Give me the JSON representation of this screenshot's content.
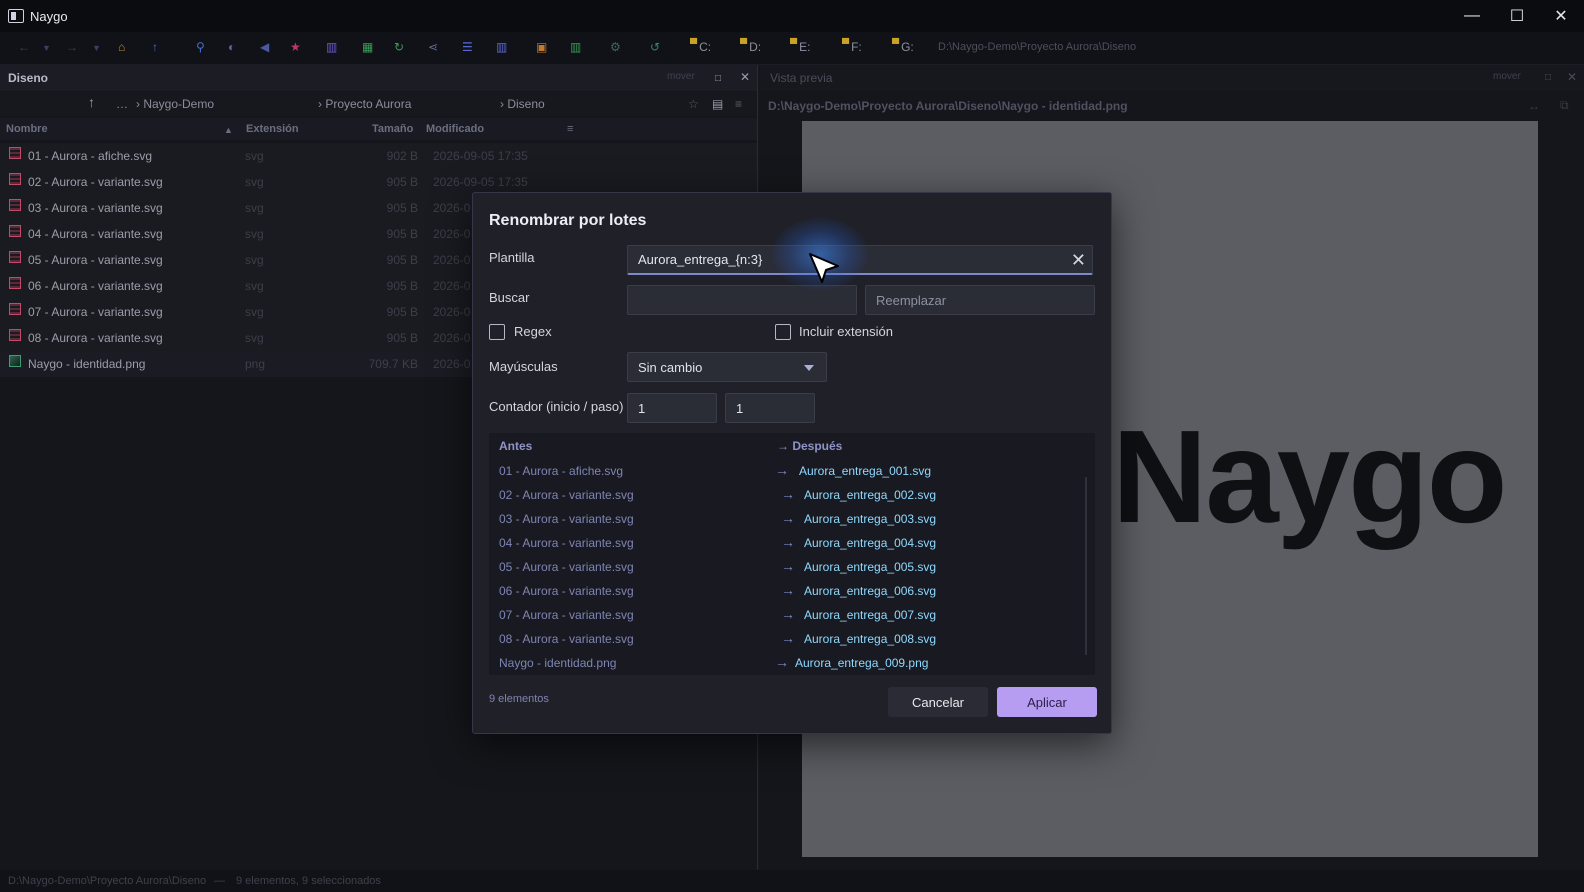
{
  "window": {
    "title": "Naygo",
    "minimize": "—",
    "maximize": "☐",
    "close": "✕"
  },
  "toolbar": {
    "icons": [
      "back-icon",
      "forward-icon",
      "home-icon",
      "up-icon",
      "search-icon",
      "contrast-icon",
      "bookmark-icon",
      "star-icon",
      "columns-icon",
      "grid-icon",
      "refresh-icon",
      "share-icon",
      "list-icon",
      "split-icon",
      "lock-icon",
      "panels-icon",
      "settings-icon",
      "sync-icon"
    ],
    "drives": [
      "C:",
      "D:",
      "E:",
      "F:",
      "G:"
    ],
    "path": "D:\\Naygo-Demo\\Proyecto Aurora\\Diseno"
  },
  "left_panel": {
    "title": "Diseno",
    "mover": "mover",
    "breadcrumb": [
      "…",
      "› Naygo-Demo",
      "› Proyecto Aurora",
      "› Diseno"
    ],
    "columns": {
      "name": "Nombre",
      "sort": "▲",
      "ext": "Extensión",
      "size": "Tamaño",
      "modified": "Modificado",
      "menu": "≡"
    },
    "rows": [
      {
        "name": "01 - Aurora - afiche.svg",
        "ext": "svg",
        "size": "902 B",
        "date": "2026-09-05 17:35",
        "type": "svg"
      },
      {
        "name": "02 - Aurora - variante.svg",
        "ext": "svg",
        "size": "905 B",
        "date": "2026-09-05 17:35",
        "type": "svg"
      },
      {
        "name": "03 - Aurora - variante.svg",
        "ext": "svg",
        "size": "905 B",
        "date": "2026-0",
        "type": "svg"
      },
      {
        "name": "04 - Aurora - variante.svg",
        "ext": "svg",
        "size": "905 B",
        "date": "2026-0",
        "type": "svg"
      },
      {
        "name": "05 - Aurora - variante.svg",
        "ext": "svg",
        "size": "905 B",
        "date": "2026-0",
        "type": "svg"
      },
      {
        "name": "06 - Aurora - variante.svg",
        "ext": "svg",
        "size": "905 B",
        "date": "2026-0",
        "type": "svg"
      },
      {
        "name": "07 - Aurora - variante.svg",
        "ext": "svg",
        "size": "905 B",
        "date": "2026-0",
        "type": "svg"
      },
      {
        "name": "08 - Aurora - variante.svg",
        "ext": "svg",
        "size": "905 B",
        "date": "2026-0",
        "type": "svg"
      },
      {
        "name": "Naygo - identidad.png",
        "ext": "png",
        "size": "709.7 KB",
        "date": "2026-0",
        "type": "png"
      }
    ]
  },
  "right_panel": {
    "title": "Vista previa",
    "mover": "mover",
    "path": "D:\\Naygo-Demo\\Proyecto Aurora\\Diseno\\Naygo - identidad.png",
    "logo_text": "Naygo"
  },
  "status": {
    "path": "D:\\Naygo-Demo\\Proyecto Aurora\\Diseno",
    "sep": "—",
    "summary": "9 elementos, 9 seleccionados"
  },
  "dialog": {
    "title": "Renombrar por lotes",
    "template_label": "Plantilla",
    "template_value": "Aurora_entrega_{n:3}",
    "search_label": "Buscar",
    "search_value": "",
    "replace_placeholder": "Reemplazar",
    "regex_label": "Regex",
    "include_ext_label": "Incluir extensión",
    "case_label": "Mayúsculas",
    "case_value": "Sin cambio",
    "counter_label": "Contador (inicio / paso)",
    "counter_start": "1",
    "counter_step": "1",
    "before_header": "Antes",
    "after_header": "→ Después",
    "arrow": "→",
    "preview": [
      {
        "before": "01 - Aurora - afiche.svg",
        "after": "Aurora_entrega_001.svg"
      },
      {
        "before": "02 - Aurora - variante.svg",
        "after": "Aurora_entrega_002.svg"
      },
      {
        "before": "03 - Aurora - variante.svg",
        "after": "Aurora_entrega_003.svg"
      },
      {
        "before": "04 - Aurora - variante.svg",
        "after": "Aurora_entrega_004.svg"
      },
      {
        "before": "05 - Aurora - variante.svg",
        "after": "Aurora_entrega_005.svg"
      },
      {
        "before": "06 - Aurora - variante.svg",
        "after": "Aurora_entrega_006.svg"
      },
      {
        "before": "07 - Aurora - variante.svg",
        "after": "Aurora_entrega_007.svg"
      },
      {
        "before": "08 - Aurora - variante.svg",
        "after": "Aurora_entrega_008.svg"
      },
      {
        "before": "Naygo - identidad.png",
        "after": "Aurora_entrega_009.png"
      }
    ],
    "count_text": "9 elementos",
    "cancel_label": "Cancelar",
    "apply_label": "Aplicar"
  }
}
